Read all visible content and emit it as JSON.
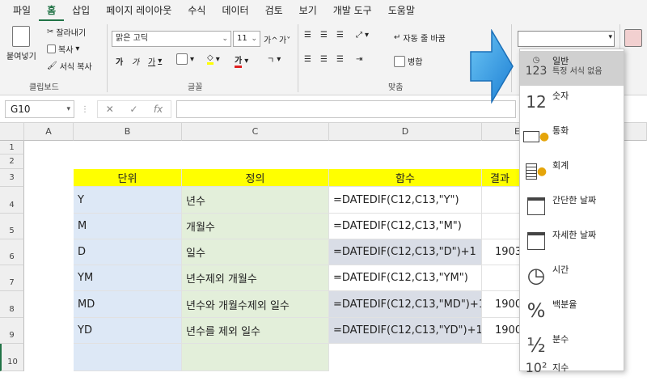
{
  "menu": [
    "파일",
    "홈",
    "삽입",
    "페이지 레이아웃",
    "수식",
    "데이터",
    "검토",
    "보기",
    "개발 도구",
    "도움말"
  ],
  "ribbon": {
    "paste": "붙여넣기",
    "cut": "잘라내기",
    "copy": "복사",
    "format_painter": "서식 복사",
    "clipboard_group": "클립보드",
    "font_name": "맑은 고딕",
    "font_size": "11",
    "font_group": "글꼴",
    "wrap_text": "자동 줄 바꿈",
    "merge": "병합",
    "align_group": "맞춤",
    "grow_font": "가^",
    "shrink_font": "가˅",
    "bold": "가",
    "italic": "가",
    "underline": "가",
    "font_color": "가"
  },
  "formula_bar": {
    "name_box": "G10",
    "cancel": "✕",
    "enter": "✓",
    "fx": "fx",
    "formula": ""
  },
  "columns": [
    "A",
    "B",
    "C",
    "D",
    "E"
  ],
  "rows": [
    "1",
    "2",
    "3",
    "4",
    "5",
    "6",
    "7",
    "8",
    "9",
    "10"
  ],
  "table": {
    "headers": [
      "단위",
      "정의",
      "함수",
      "결과"
    ],
    "rows": [
      {
        "unit": "Y",
        "def": "년수",
        "func": "=DATEDIF(C12,C13,\"Y\")",
        "result": ""
      },
      {
        "unit": "M",
        "def": "개월수",
        "func": "=DATEDIF(C12,C13,\"M\")",
        "result": ""
      },
      {
        "unit": "D",
        "def": "일수",
        "func": "=DATEDIF(C12,C13,\"D\")+1",
        "result": "1903"
      },
      {
        "unit": "YM",
        "def": "년수제외 개월수",
        "func": "=DATEDIF(C12,C13,\"YM\")",
        "result": ""
      },
      {
        "unit": "MD",
        "def": "년수와 개월수제외 일수",
        "func": "=DATEDIF(C12,C13,\"MD\")+1",
        "result": "1900"
      },
      {
        "unit": "YD",
        "def": "년수를 제외 일수",
        "func": "=DATEDIF(C12,C13,\"YD\")+1",
        "result": "1900"
      }
    ]
  },
  "number_format": {
    "current": "",
    "items": [
      {
        "label": "일반",
        "sub": "특정 서식 없음",
        "icon": "123"
      },
      {
        "label": "숫자",
        "icon": "12"
      },
      {
        "label": "통화",
        "icon": "currency-icon"
      },
      {
        "label": "회계",
        "icon": "accounting-icon"
      },
      {
        "label": "간단한 날짜",
        "icon": "calendar-icon"
      },
      {
        "label": "자세한 날짜",
        "icon": "calendar-icon"
      },
      {
        "label": "시간",
        "icon": "clock-icon"
      },
      {
        "label": "백분율",
        "icon": "%"
      },
      {
        "label": "분수",
        "icon": "½"
      },
      {
        "label": "지수",
        "icon": "10²"
      }
    ]
  },
  "colors": {
    "accent": "#217346",
    "arrow": "#2aa3e8",
    "yellow": "#ffff00"
  }
}
